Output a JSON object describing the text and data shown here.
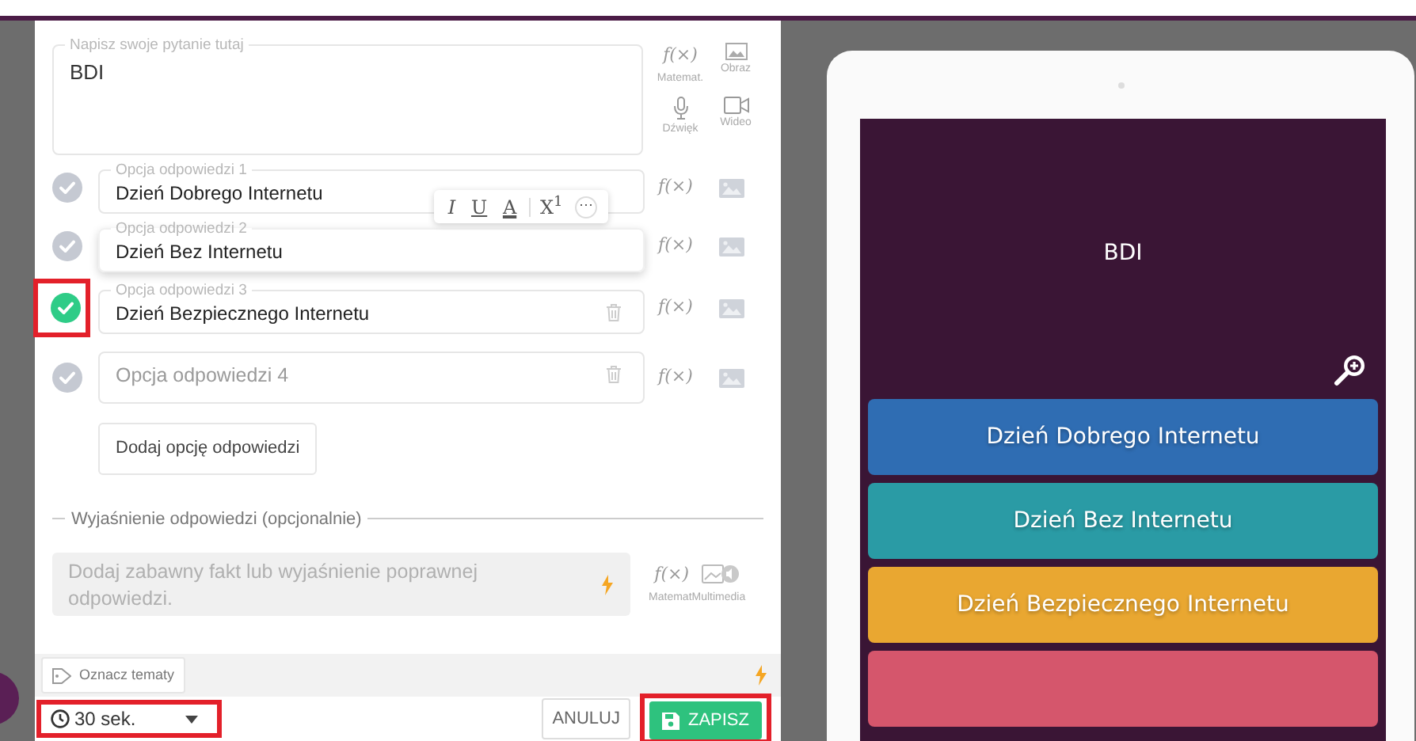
{
  "editor": {
    "question": {
      "label": "Napisz swoje pytanie tutaj",
      "value": "BDI",
      "tools": [
        {
          "kind": "math",
          "symbol": "f(×)",
          "label": "Matemat."
        },
        {
          "kind": "image",
          "label": "Obraz"
        },
        {
          "kind": "audio",
          "label": "Dźwięk"
        },
        {
          "kind": "video",
          "label": "Wideo"
        }
      ]
    },
    "options": [
      {
        "label": "Opcja odpowiedzi 1",
        "value": "Dzień Dobrego Internetu",
        "correct": false,
        "focused": false,
        "highlighted": false,
        "deletable": false,
        "math_symbol": "f(×)"
      },
      {
        "label": "Opcja odpowiedzi 2",
        "value": "Dzień Bez Internetu",
        "correct": false,
        "focused": true,
        "highlighted": false,
        "deletable": false,
        "math_symbol": "f(×)"
      },
      {
        "label": "Opcja odpowiedzi 3",
        "value": "Dzień Bezpiecznego Internetu",
        "correct": true,
        "focused": false,
        "highlighted": true,
        "deletable": true,
        "math_symbol": "f(×)"
      },
      {
        "placeholder": "Opcja odpowiedzi 4",
        "correct": false,
        "focused": false,
        "highlighted": false,
        "deletable": true,
        "math_symbol": "f(×)"
      }
    ],
    "format_toolbar": [
      {
        "kind": "italic",
        "text": "I"
      },
      {
        "kind": "underline",
        "text": "U"
      },
      {
        "kind": "color",
        "text": "A"
      },
      {
        "kind": "superscript",
        "text": "X$^{1}$"
      },
      {
        "kind": "more",
        "text": "⋯"
      }
    ],
    "add_option_button": "Dodaj opcję odpowiedzi",
    "explanation": {
      "label": "Wyjaśnienie odpowiedzi (opcjonalnie)",
      "placeholder": "Dodaj zabawny fakt lub wyjaśnienie poprawnej odpowiedzi.",
      "math_symbol": "f(×)",
      "tool_labels": [
        "Matemat",
        "Multimedia"
      ]
    },
    "tags_button": "Oznacz tematy",
    "timer": {
      "value": "30 sek.",
      "highlighted": true
    },
    "cancel_button": "ANULUJ",
    "save_button": {
      "label": "ZAPISZ",
      "highlighted": true
    }
  },
  "preview": {
    "question": "BDI",
    "answers": [
      {
        "text": "Dzień Dobrego Internetu",
        "color": "#2f6db3"
      },
      {
        "text": "Dzień Bez Internetu",
        "color": "#2a9ba5"
      },
      {
        "text": "Dzień Bezpiecznego Internetu",
        "color": "#e9a731"
      },
      {
        "color": "#d5566c"
      }
    ]
  }
}
